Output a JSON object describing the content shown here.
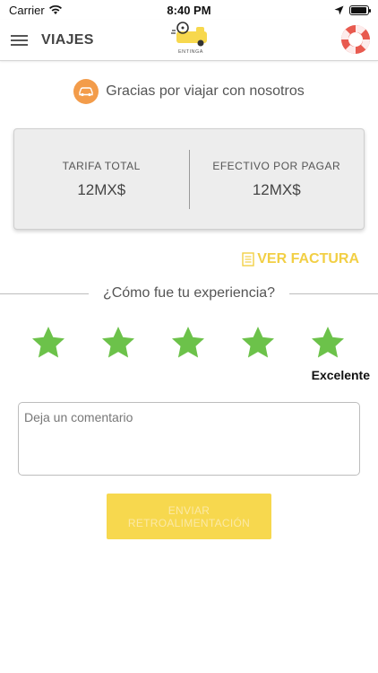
{
  "status_bar": {
    "carrier": "Carrier",
    "time": "8:40 PM"
  },
  "nav": {
    "title": "VIAJES",
    "logo_text": "ENTINGA"
  },
  "thanks": {
    "text": "Gracias por viajar con nosotros"
  },
  "fare": {
    "total_label": "TARIFA TOTAL",
    "total_value": "12MX$",
    "cash_label": "EFECTIVO POR PAGAR",
    "cash_value": "12MX$"
  },
  "invoice": {
    "label": "VER FACTURA"
  },
  "experience": {
    "question": "¿Cómo fue tu experiencia?",
    "rating": 5,
    "max_rating": 5,
    "rating_label": "Excelente"
  },
  "comment": {
    "placeholder": "Deja un comentario",
    "value": ""
  },
  "submit": {
    "label": "ENVIAR RETROALIMENTACIÓN"
  },
  "colors": {
    "accent_yellow": "#f7d84e",
    "star_green": "#6cc24a",
    "car_orange": "#f39c4a",
    "help_red": "#e85a4f"
  }
}
